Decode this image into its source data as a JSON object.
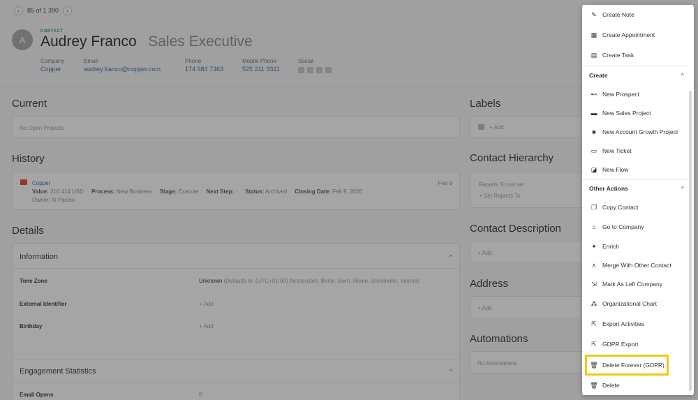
{
  "pager": {
    "text": "85 of 1 390",
    "prev_icon": "‹",
    "next_icon": "›"
  },
  "contact": {
    "avatar_letter": "A",
    "type_label": "CONTACT",
    "name": "Audrey Franco",
    "job_title": "Sales Executive",
    "company_label": "Company",
    "company": "Copper",
    "email_label": "Email",
    "email": "audrey.franco@copper.com",
    "phone_label": "Phone",
    "phone": "174 983 7363",
    "mobile_label": "Mobile Phone",
    "mobile": "525 211 3311",
    "social_label": "Social"
  },
  "current": {
    "title": "Current",
    "empty": "No Open Projects"
  },
  "history": {
    "title": "History",
    "item": {
      "name": "Copper",
      "date": "Feb 9",
      "value_label": "Value:",
      "value": "316 414 USD",
      "process_label": "Process:",
      "process": "New Business",
      "stage_label": "Stage:",
      "stage": "Execute",
      "next_label": "Next Step:",
      "next": "-",
      "status_label": "Status:",
      "status": "Archived",
      "closing_label": "Closing Date:",
      "closing": "Feb 9, 2026",
      "owner_label": "Owner:",
      "owner": "Al Pacino"
    }
  },
  "details": {
    "title": "Details",
    "information": "Information",
    "rows": [
      {
        "label": "Time Zone",
        "value": "Unknown",
        "note": "(Defaults to: (UTC+01:00) Amsterdam, Berlin, Bern, Rome, Stockholm, Vienna)"
      },
      {
        "label": "External Identifier",
        "value": "+ Add"
      },
      {
        "label": "Birthday",
        "value": "+ Add"
      }
    ],
    "engagement": "Engagement Statistics",
    "email_opens_label": "Email Opens",
    "email_opens": "0"
  },
  "labels": {
    "title": "Labels",
    "add": "+ Add"
  },
  "hierarchy": {
    "title": "Contact Hierarchy",
    "reports": "Reports To not set",
    "set": "+ Set Reports To"
  },
  "description": {
    "title": "Contact Description",
    "add": "+ Add"
  },
  "address": {
    "title": "Address",
    "add": "+ Add"
  },
  "automations": {
    "title": "Automations",
    "empty": "No Automations"
  },
  "menu": {
    "top": [
      {
        "label": "Create Note",
        "icon": "note-icon",
        "glyph": "✎"
      },
      {
        "label": "Create Appointment",
        "icon": "calendar-icon",
        "glyph": "▦"
      },
      {
        "label": "Create Task",
        "icon": "clipboard-icon",
        "glyph": "▤"
      }
    ],
    "create_title": "Create",
    "create": [
      {
        "label": "New Prospect",
        "icon": "binoculars-icon",
        "glyph": "⊷"
      },
      {
        "label": "New Sales Project",
        "icon": "wallet-icon",
        "glyph": "▬"
      },
      {
        "label": "New Account Growth Project",
        "icon": "briefcase-icon",
        "glyph": "■"
      },
      {
        "label": "New Ticket",
        "icon": "ticket-icon",
        "glyph": "▭"
      },
      {
        "label": "New Flow",
        "icon": "flow-icon",
        "glyph": "◪"
      }
    ],
    "other_title": "Other Actions",
    "other": [
      {
        "label": "Copy Contact",
        "icon": "copy-icon",
        "glyph": "❐"
      },
      {
        "label": "Go to Company",
        "icon": "home-icon",
        "glyph": "⌂"
      },
      {
        "label": "Enrich",
        "icon": "enrich-icon",
        "glyph": "✦"
      },
      {
        "label": "Merge With Other Contact",
        "icon": "merge-icon",
        "glyph": "⋏"
      },
      {
        "label": "Mark As Left Company",
        "icon": "left-company-icon",
        "glyph": "⇲"
      },
      {
        "label": "Organizational Chart",
        "icon": "org-chart-icon",
        "glyph": "⁂"
      },
      {
        "label": "Export Activities",
        "icon": "export-icon",
        "glyph": "⇱"
      },
      {
        "label": "GDPR Export",
        "icon": "export-icon",
        "glyph": "⇱"
      },
      {
        "label": "Delete Forever (GDPR)",
        "icon": "trash-icon",
        "glyph": "🗑"
      },
      {
        "label": "Delete",
        "icon": "trash-icon",
        "glyph": "🗑"
      }
    ],
    "chevron": "^",
    "highlight_color": "#f2c80f"
  }
}
